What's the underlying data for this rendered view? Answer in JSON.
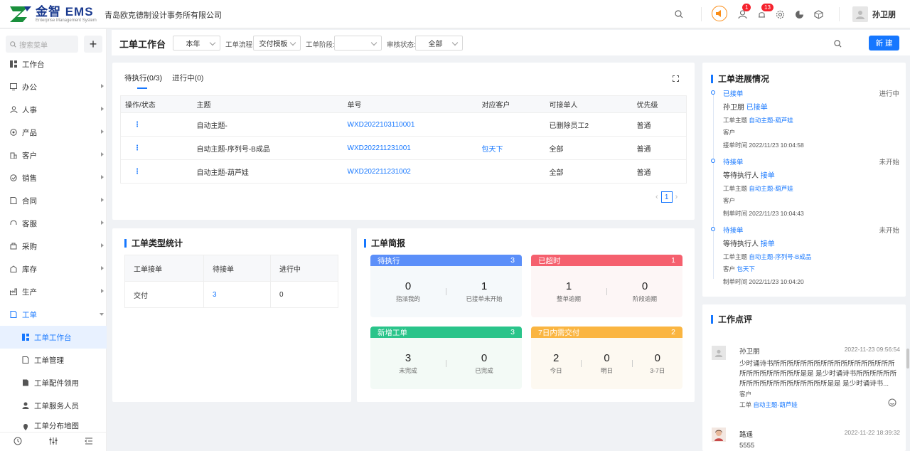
{
  "header": {
    "logo_text": "金智 EMS",
    "logo_sub": "Enterprise Management System",
    "company": "青岛欧克德制设计事务所有限公司",
    "badges": {
      "contacts": "1",
      "notifications": "13"
    },
    "user_name": "孙卫朋",
    "accent": "#1677ff"
  },
  "sidebar": {
    "search_placeholder": "搜索菜单",
    "items": [
      {
        "label": "工作台",
        "icon": "dashboard-icon"
      },
      {
        "label": "办公",
        "icon": "monitor-icon"
      },
      {
        "label": "人事",
        "icon": "people-icon"
      },
      {
        "label": "产品",
        "icon": "cube-icon"
      },
      {
        "label": "客户",
        "icon": "building-icon"
      },
      {
        "label": "销售",
        "icon": "sale-icon"
      },
      {
        "label": "合同",
        "icon": "contract-icon"
      },
      {
        "label": "客服",
        "icon": "headset-icon"
      },
      {
        "label": "采购",
        "icon": "cart-icon"
      },
      {
        "label": "库存",
        "icon": "warehouse-icon"
      },
      {
        "label": "生产",
        "icon": "factory-icon"
      },
      {
        "label": "工单",
        "icon": "document-icon"
      }
    ],
    "sub_items": [
      {
        "label": "工单工作台",
        "icon": "dashboard-icon"
      },
      {
        "label": "工单管理",
        "icon": "document-icon"
      },
      {
        "label": "工单配件领用",
        "icon": "document-icon"
      },
      {
        "label": "工单服务人员",
        "icon": "person-icon"
      },
      {
        "label": "工单分布地图",
        "icon": "map-icon"
      }
    ]
  },
  "toolbar": {
    "title": "工单工作台",
    "period": "本年",
    "flow_label": "工单流程:",
    "flow_value": "交付模板",
    "stage_label": "工单阶段:",
    "stage_value": "",
    "review_label": "审核状态:",
    "review_value": "全部",
    "new_button": "新 建"
  },
  "worklist": {
    "tabs": [
      "待执行(0/3)",
      "进行中(0)"
    ],
    "columns": [
      "操作/状态",
      "主题",
      "单号",
      "对应客户",
      "可接单人",
      "优先级"
    ],
    "rows": [
      {
        "action": "⋮",
        "subject": "自动主题-",
        "number": "WXD2022103110001",
        "customer": "",
        "assignee": "已删除员工2",
        "priority": "普通"
      },
      {
        "action": "⋮",
        "subject": "自动主题-序列号-B成品",
        "number": "WXD202211231001",
        "customer": "包天下",
        "assignee": "全部",
        "priority": "普通"
      },
      {
        "action": "⋮",
        "subject": "自动主题-葫芦娃",
        "number": "WXD202211231002",
        "customer": "",
        "assignee": "全部",
        "priority": "普通"
      }
    ],
    "page": "1"
  },
  "type_stats": {
    "title": "工单类型统计",
    "columns": [
      "工单接单",
      "待接单",
      "进行中"
    ],
    "rows": [
      {
        "type": "交付",
        "pending": "3",
        "in_progress": "0"
      }
    ]
  },
  "brief": {
    "title": "工单简报",
    "boxes": [
      {
        "title": "待执行",
        "count": "3",
        "color": "#5b8ff9",
        "cols": [
          {
            "n": "0",
            "t": "指派我的"
          },
          {
            "n": "1",
            "t": "已接单未开始"
          }
        ]
      },
      {
        "title": "已超时",
        "count": "1",
        "color": "#f5606e",
        "cols": [
          {
            "n": "1",
            "t": "整单逾期"
          },
          {
            "n": "0",
            "t": "阶段逾期"
          }
        ]
      },
      {
        "title": "新增工单",
        "count": "3",
        "color": "#2ac48a",
        "cols": [
          {
            "n": "3",
            "t": "未完成"
          },
          {
            "n": "0",
            "t": "已完成"
          }
        ]
      },
      {
        "title": "7日内需交付",
        "count": "2",
        "color": "#fab541",
        "cols": [
          {
            "n": "2",
            "t": "今日"
          },
          {
            "n": "0",
            "t": "明日"
          },
          {
            "n": "0",
            "t": "3-7日"
          }
        ]
      }
    ]
  },
  "progress": {
    "title": "工单进展情况",
    "items": [
      {
        "status": "已接单",
        "state": "进行中",
        "line2_a": "孙卫朋",
        "line2_b": "已接单",
        "subject_label": "工单主题",
        "subject": "自动主题-葫芦娃",
        "customer_label": "客户",
        "customer": "",
        "time_label": "接单时间",
        "time": "2022/11/23 10:04:58"
      },
      {
        "status": "待接单",
        "state": "未开始",
        "line2_a": "等待执行人",
        "line2_b": "接单",
        "subject_label": "工单主题",
        "subject": "自动主题-葫芦娃",
        "customer_label": "客户",
        "customer": "",
        "time_label": "制单时间",
        "time": "2022/11/23 10:04:43"
      },
      {
        "status": "待接单",
        "state": "未开始",
        "line2_a": "等待执行人",
        "line2_b": "接单",
        "subject_label": "工单主题",
        "subject": "自动主题-序列号-B成品",
        "customer_label": "客户",
        "customer": "包天下",
        "time_label": "制单时间",
        "time": "2022/11/23 10:04:20"
      }
    ]
  },
  "comments": {
    "title": "工作点评",
    "items": [
      {
        "name": "孙卫朋",
        "time": "2022-11-23 09:56:54",
        "text": "少时诵诗书所所所所所所所所所所所所所所所所所所所所所所所所所所所是是 是少时诵诗书所所所所所所所所所所所所所所所所所所所是是 是少时诵诗书...",
        "customer_label": "客户",
        "order_label": "工单",
        "order": "自动主题-葫芦娃"
      },
      {
        "name": "路遥",
        "time": "2022-11-22 18:39:32",
        "text": "5555"
      }
    ]
  }
}
